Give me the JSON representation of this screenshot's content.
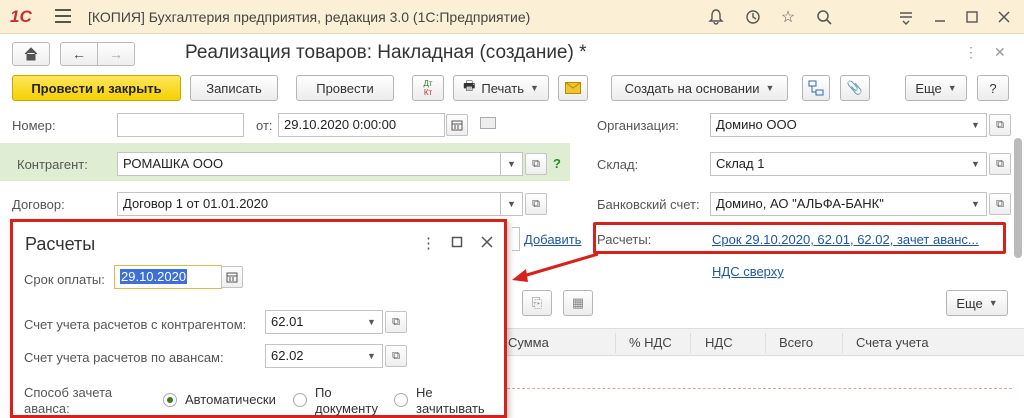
{
  "titlebar": {
    "logo": "1С",
    "title": "[КОПИЯ] Бухгалтерия предприятия, редакция 3.0  (1С:Предприятие)",
    "icons": [
      "bell-icon",
      "history-icon",
      "star-icon",
      "search-icon",
      "settings-icon",
      "minimize-icon",
      "maximize-icon",
      "close-icon"
    ]
  },
  "header": {
    "title": "Реализация товаров: Накладная (создание) *"
  },
  "toolbar": {
    "post_close": "Провести и закрыть",
    "save": "Записать",
    "post": "Провести",
    "dtkt": "Дт\nКт",
    "print": "Печать",
    "create_based": "Создать на основании",
    "more": "Еще",
    "help": "?"
  },
  "form": {
    "number_label": "Номер:",
    "number_value": "",
    "from_label": "от:",
    "date_value": "29.10.2020  0:00:00",
    "org_label": "Организация:",
    "org_value": "Домино ООО",
    "counterparty_label": "Контрагент:",
    "counterparty_value": "РОМАШКА ООО",
    "warehouse_label": "Склад:",
    "warehouse_value": "Склад 1",
    "contract_label": "Договор:",
    "contract_value": "Договор 1 от 01.01.2020",
    "bank_label": "Банковский счет:",
    "bank_value": "Домино, АО \"АЛЬФА-БАНК\"",
    "add_link": "Добавить",
    "settlements_label": "Расчеты:",
    "settlements_link": "Срок 29.10.2020, 62.01, 62.02, зачет аванс...",
    "vat_link": "НДС сверху",
    "help_q": "?"
  },
  "popup": {
    "title": "Расчеты",
    "due_label": "Срок оплаты:",
    "due_value": "29.10.2020",
    "acc_counterparty_label": "Счет учета расчетов с контрагентом:",
    "acc_counterparty_value": "62.01",
    "acc_advance_label": "Счет учета расчетов по авансам:",
    "acc_advance_value": "62.02",
    "advance_label_1": "Способ зачета",
    "advance_label_2": "аванса:",
    "options": [
      {
        "label_1": "Автоматически",
        "label_2": "",
        "selected": true
      },
      {
        "label_1": "По",
        "label_2": "документу",
        "selected": false
      },
      {
        "label_1": "Не",
        "label_2": "зачитывать",
        "selected": false
      }
    ]
  },
  "table": {
    "more": "Еще",
    "columns": [
      "Сумма",
      "% НДС",
      "НДС",
      "Всего",
      "Счета учета"
    ]
  },
  "colors": {
    "accent_red": "#d9211c",
    "primary_yellow": "#f5d000",
    "link_blue": "#1d56a7",
    "green_band": "#dfeed3"
  }
}
